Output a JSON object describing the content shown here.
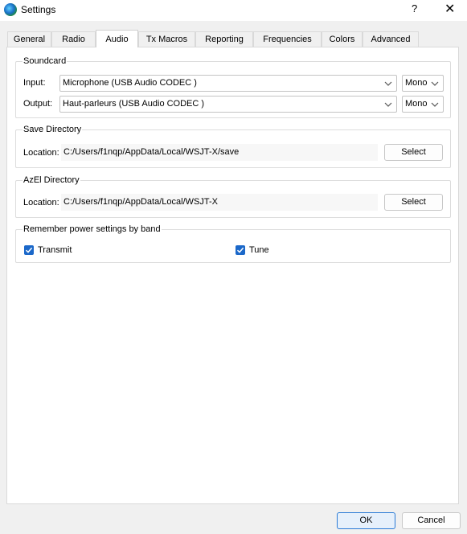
{
  "window": {
    "title": "Settings",
    "help_glyph": "?",
    "close_glyph": "✕",
    "icon": "wsjt-globe-icon"
  },
  "tabs": [
    {
      "label": "General",
      "active": false
    },
    {
      "label": "Radio",
      "active": false
    },
    {
      "label": "Audio",
      "active": true
    },
    {
      "label": "Tx Macros",
      "active": false
    },
    {
      "label": "Reporting",
      "active": false
    },
    {
      "label": "Frequencies",
      "active": false
    },
    {
      "label": "Colors",
      "active": false
    },
    {
      "label": "Advanced",
      "active": false
    }
  ],
  "soundcard": {
    "title": "Soundcard",
    "input_label": "Input:",
    "input_value": "Microphone (USB Audio CODEC )",
    "input_channel": "Mono",
    "output_label": "Output:",
    "output_value": "Haut-parleurs (USB Audio CODEC )",
    "output_channel": "Mono"
  },
  "save_directory": {
    "title": "Save Directory",
    "location_label": "Location:",
    "path": "C:/Users/f1nqp/AppData/Local/WSJT-X/save",
    "select_label": "Select"
  },
  "azel_directory": {
    "title": "AzEl Directory",
    "location_label": "Location:",
    "path": "C:/Users/f1nqp/AppData/Local/WSJT-X",
    "select_label": "Select"
  },
  "power": {
    "title": "Remember power settings by band",
    "transmit_label": "Transmit",
    "transmit_checked": true,
    "tune_label": "Tune",
    "tune_checked": true
  },
  "footer": {
    "ok_label": "OK",
    "cancel_label": "Cancel"
  },
  "colors": {
    "accent": "#1b68c9",
    "default_button_border": "#2a7ad6"
  }
}
